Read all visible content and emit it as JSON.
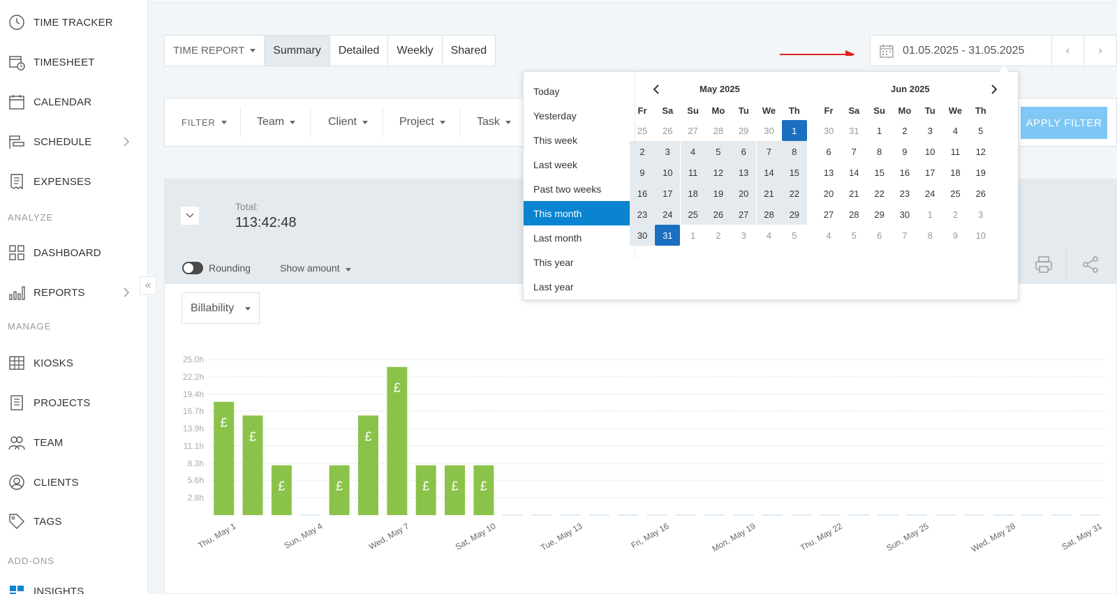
{
  "sidebar": {
    "items": [
      {
        "label": "TIME TRACKER",
        "icon": "clock-icon"
      },
      {
        "label": "TIMESHEET",
        "icon": "timesheet-icon"
      },
      {
        "label": "CALENDAR",
        "icon": "calendar-icon"
      },
      {
        "label": "SCHEDULE",
        "icon": "schedule-icon"
      },
      {
        "label": "EXPENSES",
        "icon": "receipt-icon"
      },
      {
        "label": "DASHBOARD",
        "icon": "dashboard-icon"
      },
      {
        "label": "REPORTS",
        "icon": "bar-chart-icon"
      },
      {
        "label": "KIOSKS",
        "icon": "kiosk-icon"
      },
      {
        "label": "PROJECTS",
        "icon": "document-icon"
      },
      {
        "label": "TEAM",
        "icon": "team-icon"
      },
      {
        "label": "CLIENTS",
        "icon": "client-icon"
      },
      {
        "label": "TAGS",
        "icon": "tag-icon"
      },
      {
        "label": "INSIGHTS",
        "icon": "insights-icon"
      }
    ],
    "sections": {
      "analyze": "ANALYZE",
      "manage": "MANAGE",
      "addons": "ADD-ONS"
    }
  },
  "report_tabs": {
    "dropdown": "TIME REPORT",
    "tabs": [
      "Summary",
      "Detailed",
      "Weekly",
      "Shared"
    ],
    "active": "Summary"
  },
  "date_range": {
    "value": "01.05.2025 - 31.05.2025",
    "prev": "‹",
    "next": "›"
  },
  "filters": {
    "filter_label": "FILTER",
    "items": [
      "Team",
      "Client",
      "Project",
      "Task"
    ],
    "apply": "APPLY FILTER"
  },
  "summary": {
    "total_label": "Total:",
    "total_value": "113:42:48",
    "rounding_label": "Rounding",
    "show_amount": "Show amount"
  },
  "billability": {
    "label": "Billability"
  },
  "date_dropdown": {
    "presets": [
      "Today",
      "Yesterday",
      "This week",
      "Last week",
      "Past two weeks",
      "This month",
      "Last month",
      "This year",
      "Last year"
    ],
    "active_preset": "This month",
    "weekdays": [
      "Fr",
      "Sa",
      "Su",
      "Mo",
      "Tu",
      "We",
      "Th"
    ],
    "months": [
      {
        "title": "May 2025",
        "weeks": [
          [
            {
              "d": "25",
              "m": 1
            },
            {
              "d": "26",
              "m": 1
            },
            {
              "d": "27",
              "m": 1
            },
            {
              "d": "28",
              "m": 1
            },
            {
              "d": "29",
              "m": 1
            },
            {
              "d": "30",
              "m": 1
            },
            {
              "d": "1",
              "s": 1
            }
          ],
          [
            {
              "d": "2",
              "r": 1
            },
            {
              "d": "3",
              "r": 1
            },
            {
              "d": "4",
              "r": 1
            },
            {
              "d": "5",
              "r": 1
            },
            {
              "d": "6",
              "r": 1
            },
            {
              "d": "7",
              "r": 1
            },
            {
              "d": "8",
              "r": 1
            }
          ],
          [
            {
              "d": "9",
              "r": 1
            },
            {
              "d": "10",
              "r": 1
            },
            {
              "d": "11",
              "r": 1
            },
            {
              "d": "12",
              "r": 1
            },
            {
              "d": "13",
              "r": 1
            },
            {
              "d": "14",
              "r": 1
            },
            {
              "d": "15",
              "r": 1
            }
          ],
          [
            {
              "d": "16",
              "r": 1
            },
            {
              "d": "17",
              "r": 1
            },
            {
              "d": "18",
              "r": 1
            },
            {
              "d": "19",
              "r": 1
            },
            {
              "d": "20",
              "r": 1
            },
            {
              "d": "21",
              "r": 1
            },
            {
              "d": "22",
              "r": 1
            }
          ],
          [
            {
              "d": "23",
              "r": 1
            },
            {
              "d": "24",
              "r": 1
            },
            {
              "d": "25",
              "r": 1
            },
            {
              "d": "26",
              "r": 1
            },
            {
              "d": "27",
              "r": 1
            },
            {
              "d": "28",
              "r": 1
            },
            {
              "d": "29",
              "r": 1
            }
          ],
          [
            {
              "d": "30",
              "r": 1
            },
            {
              "d": "31",
              "s": 1
            },
            {
              "d": "1",
              "m": 1
            },
            {
              "d": "2",
              "m": 1
            },
            {
              "d": "3",
              "m": 1
            },
            {
              "d": "4",
              "m": 1
            },
            {
              "d": "5",
              "m": 1
            }
          ]
        ]
      },
      {
        "title": "Jun 2025",
        "weeks": [
          [
            {
              "d": "30",
              "m": 1
            },
            {
              "d": "31",
              "m": 1
            },
            {
              "d": "1"
            },
            {
              "d": "2"
            },
            {
              "d": "3"
            },
            {
              "d": "4"
            },
            {
              "d": "5"
            }
          ],
          [
            {
              "d": "6"
            },
            {
              "d": "7"
            },
            {
              "d": "8"
            },
            {
              "d": "9"
            },
            {
              "d": "10"
            },
            {
              "d": "11"
            },
            {
              "d": "12"
            }
          ],
          [
            {
              "d": "13"
            },
            {
              "d": "14"
            },
            {
              "d": "15"
            },
            {
              "d": "16"
            },
            {
              "d": "17"
            },
            {
              "d": "18"
            },
            {
              "d": "19"
            }
          ],
          [
            {
              "d": "20"
            },
            {
              "d": "21"
            },
            {
              "d": "22"
            },
            {
              "d": "23"
            },
            {
              "d": "24"
            },
            {
              "d": "25"
            },
            {
              "d": "26"
            }
          ],
          [
            {
              "d": "27"
            },
            {
              "d": "28"
            },
            {
              "d": "29"
            },
            {
              "d": "30"
            },
            {
              "d": "1",
              "m": 1
            },
            {
              "d": "2",
              "m": 1
            },
            {
              "d": "3",
              "m": 1
            }
          ],
          [
            {
              "d": "4",
              "m": 1
            },
            {
              "d": "5",
              "m": 1
            },
            {
              "d": "6",
              "m": 1
            },
            {
              "d": "7",
              "m": 1
            },
            {
              "d": "8",
              "m": 1
            },
            {
              "d": "9",
              "m": 1
            },
            {
              "d": "10",
              "m": 1
            }
          ]
        ]
      }
    ]
  },
  "chart_data": {
    "type": "bar",
    "y_ticks": [
      "2.8h",
      "5.6h",
      "8.3h",
      "11.1h",
      "13.9h",
      "16.7h",
      "19.4h",
      "22.2h",
      "25.0h"
    ],
    "ylim": [
      0,
      25.0
    ],
    "bar_symbol": "£",
    "bar_color": "#8bc34a",
    "x_tick_labels": [
      "Thu, May 1",
      "Sun, May 4",
      "Wed, May 7",
      "Sat, May 10",
      "Tue, May 13",
      "Fri, May 16",
      "Mon, May 19",
      "Thu, May 22",
      "Sun, May 25",
      "Wed, May 28",
      "Sat, May 31"
    ],
    "categories": [
      "May 1",
      "May 2",
      "May 3",
      "May 4",
      "May 5",
      "May 6",
      "May 7",
      "May 8",
      "May 9",
      "May 10",
      "May 11",
      "May 12",
      "May 13",
      "May 14",
      "May 15",
      "May 16",
      "May 17",
      "May 18",
      "May 19",
      "May 20",
      "May 21",
      "May 22",
      "May 23",
      "May 24",
      "May 25",
      "May 26",
      "May 27",
      "May 28",
      "May 29",
      "May 30",
      "May 31"
    ],
    "values": [
      18.2,
      16.0,
      8.0,
      0,
      8.0,
      16.0,
      23.8,
      8.0,
      8.0,
      8.0,
      0,
      0,
      0,
      0,
      0,
      0,
      0,
      0,
      0,
      0,
      0,
      0,
      0,
      0,
      0,
      0,
      0,
      0,
      0,
      0,
      0
    ]
  }
}
